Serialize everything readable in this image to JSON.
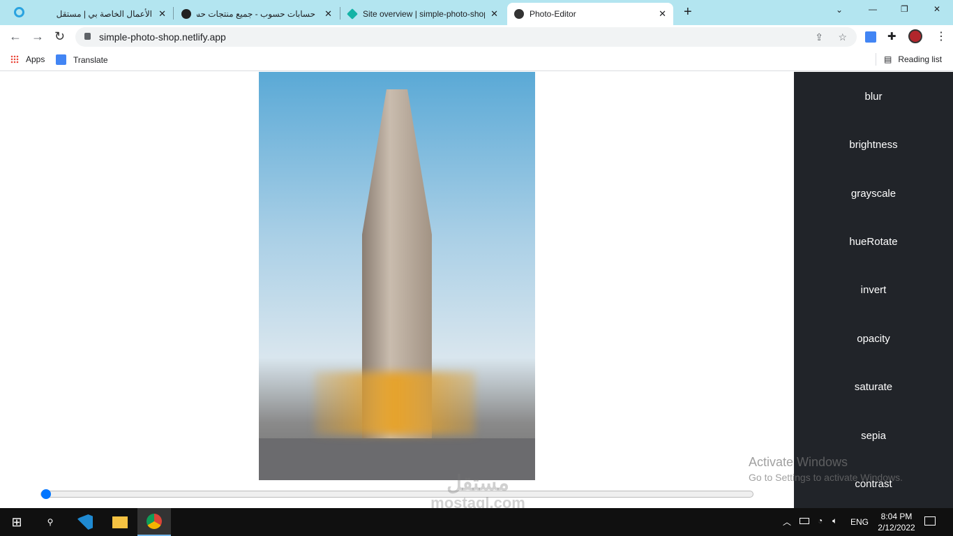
{
  "browser": {
    "tabs": [
      {
        "title": "الأعمال الخاصة بي | مستقل",
        "icon": "mostaql-icon"
      },
      {
        "title": "حسابات حسوب - جميع منتجات حسو",
        "icon": "hsoub-icon"
      },
      {
        "title": "Site overview | simple-photo-shop",
        "icon": "netlify-icon"
      },
      {
        "title": "Photo-Editor",
        "icon": "globe-icon",
        "active": true
      }
    ],
    "new_tab": "+",
    "close": "✕",
    "url": "simple-photo-shop.netlify.app",
    "bookmarks": [
      {
        "label": "Apps"
      },
      {
        "label": "Translate"
      }
    ],
    "reading_list": "Reading list"
  },
  "editor": {
    "filters": [
      "blur",
      "brightness",
      "grayscale",
      "hueRotate",
      "invert",
      "opacity",
      "saturate",
      "sepia",
      "contrast"
    ],
    "slider_value": 0,
    "photo": "Flatiron Building street photo"
  },
  "watermark": {
    "arabic": "مستقل",
    "latin": "mostaql.com"
  },
  "windows": {
    "activate_title": "Activate Windows",
    "activate_sub": "Go to Settings to activate Windows.",
    "lang": "ENG",
    "time": "8:04 PM",
    "date": "2/12/2022"
  }
}
